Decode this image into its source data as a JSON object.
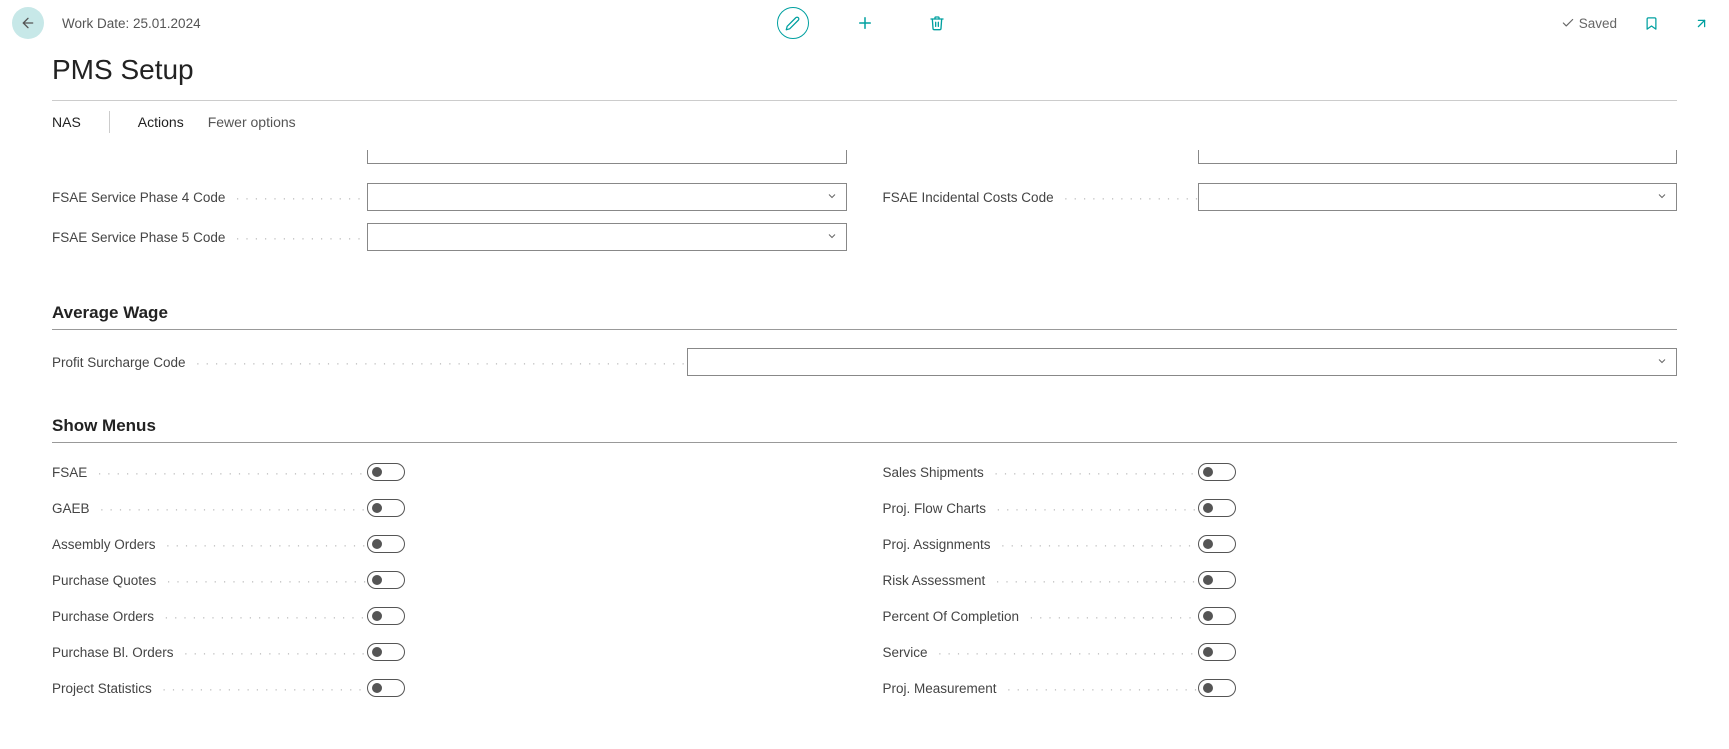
{
  "header": {
    "work_date_label": "Work Date: 25.01.2024",
    "saved_label": "Saved"
  },
  "page_title": "PMS Setup",
  "actions": {
    "nas": "NAS",
    "actions": "Actions",
    "fewer": "Fewer options"
  },
  "fields": {
    "fsae_phase4": "FSAE Service Phase 4 Code",
    "fsae_phase5": "FSAE Service Phase 5 Code",
    "fsae_incidental": "FSAE Incidental Costs Code"
  },
  "sections": {
    "average_wage": "Average Wage",
    "profit_surcharge": "Profit Surcharge Code",
    "show_menus": "Show Menus"
  },
  "toggles_left": [
    "FSAE",
    "GAEB",
    "Assembly Orders",
    "Purchase Quotes",
    "Purchase Orders",
    "Purchase Bl. Orders",
    "Project Statistics"
  ],
  "toggles_right": [
    "Sales Shipments",
    "Proj. Flow Charts",
    "Proj. Assignments",
    "Risk Assessment",
    "Percent Of Completion",
    "Service",
    "Proj. Measurement"
  ]
}
